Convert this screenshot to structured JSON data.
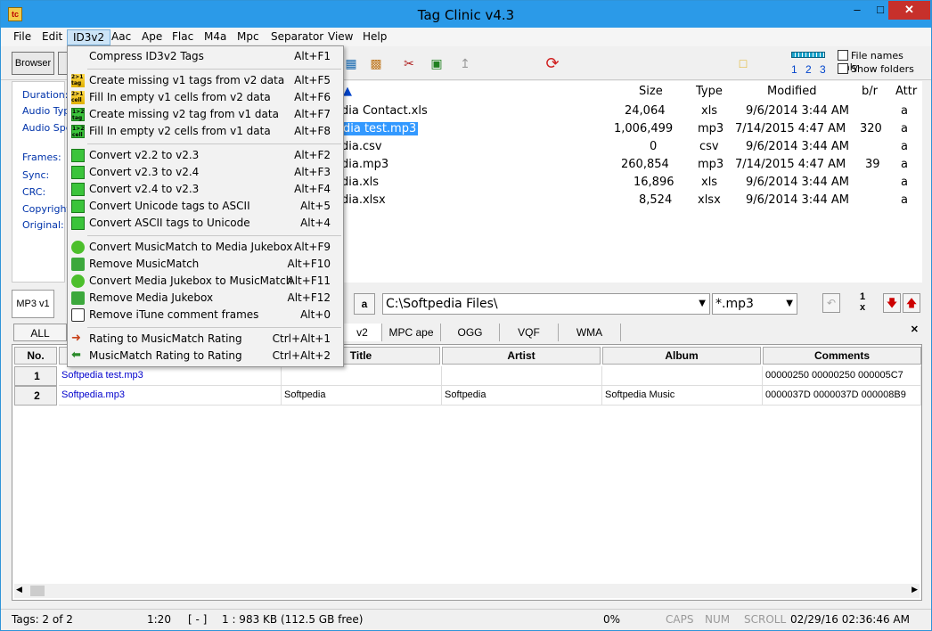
{
  "window": {
    "title": "Tag Clinic v4.3",
    "app_icon": "tag-clinic-icon"
  },
  "menubar": [
    {
      "label": "File"
    },
    {
      "label": "Edit"
    },
    {
      "label": "ID3v2"
    },
    {
      "label": "Aac"
    },
    {
      "label": "Ape"
    },
    {
      "label": "Flac"
    },
    {
      "label": "M4a"
    },
    {
      "label": "Mpc"
    },
    {
      "label": "Separator"
    },
    {
      "label": "View"
    },
    {
      "label": "Help"
    }
  ],
  "toolbar": {
    "browser_label": "Browser",
    "page_numbers": "1 2 3",
    "file_names_only": "File names only",
    "show_folders": "Show folders"
  },
  "id3v2_menu": [
    {
      "label": "Compress  ID3v2 Tags",
      "shortcut": "Alt+F1",
      "icon": "compress-icon"
    },
    {
      "label": "Create   missing v1 tags from v2 data",
      "shortcut": "Alt+F5",
      "icon": "tag-v2-to-v1-icon",
      "icon_text": "2>1 tag"
    },
    {
      "label": "Fill In    empty v1 cells from v2 data",
      "shortcut": "Alt+F6",
      "icon": "cell-v2-to-v1-icon",
      "icon_text": "2>1 cell"
    },
    {
      "label": "Create   missing v2 tag from v1 data",
      "shortcut": "Alt+F7",
      "icon": "tag-v1-to-v2-icon",
      "icon_text": "1>2 tag"
    },
    {
      "label": "Fill In    empty v2 cells from v1 data",
      "shortcut": "Alt+F8",
      "icon": "cell-v1-to-v2-icon",
      "icon_text": "1>2 cell"
    },
    {
      "label": "Convert  v2.2 to v2.3",
      "shortcut": "Alt+F2",
      "icon": "convert-icon"
    },
    {
      "label": "Convert  v2.3 to v2.4",
      "shortcut": "Alt+F3",
      "icon": "convert-icon"
    },
    {
      "label": "Convert  v2.4 to v2.3",
      "shortcut": "Alt+F4",
      "icon": "convert-icon"
    },
    {
      "label": "Convert  Unicode tags to ASCII",
      "shortcut": "Alt+5",
      "icon": "convert-icon"
    },
    {
      "label": "Convert  ASCII tags to Unicode",
      "shortcut": "Alt+4",
      "icon": "convert-icon"
    },
    {
      "label": "Convert  MusicMatch to Media Jukebox",
      "shortcut": "Alt+F9",
      "icon": "musicmatch-icon"
    },
    {
      "label": "Remove  MusicMatch",
      "shortcut": "Alt+F10",
      "icon": "trash-icon"
    },
    {
      "label": "Convert  Media Jukebox to MusicMatch",
      "shortcut": "Alt+F11",
      "icon": "jukebox-icon"
    },
    {
      "label": "Remove  Media Jukebox",
      "shortcut": "Alt+F12",
      "icon": "trash-icon"
    },
    {
      "label": "Remove  iTune comment frames",
      "shortcut": "Alt+0",
      "icon": "itunes-icon"
    },
    {
      "label": "Rating to MusicMatch Rating",
      "shortcut": "Ctrl+Alt+1",
      "icon": "arrow-right-icon"
    },
    {
      "label": "MusicMatch Rating to Rating",
      "shortcut": "Ctrl+Alt+2",
      "icon": "arrow-left-icon"
    }
  ],
  "left_panel": {
    "labels": [
      "Duration:",
      "Audio Type",
      "Audio Spec",
      "Frames:",
      "Sync:",
      "CRC:",
      "Copyright:",
      "Original:"
    ]
  },
  "file_list": {
    "columns": [
      "Size",
      "Type",
      "Modified",
      "b/r",
      "Attr"
    ],
    "rows": [
      {
        "name": "dia Contact.xls",
        "size": "24,064",
        "type": "xls",
        "modified": "9/6/2014 3:44 AM",
        "br": "",
        "attr": "a"
      },
      {
        "name": "dia test.mp3",
        "size": "1,006,499",
        "type": "mp3",
        "modified": "7/14/2015 4:47 AM",
        "br": "320",
        "attr": "a"
      },
      {
        "name": "dia.csv",
        "size": "0",
        "type": "csv",
        "modified": "9/6/2014 3:44 AM",
        "br": "",
        "attr": "a"
      },
      {
        "name": "dia.mp3",
        "size": "260,854",
        "type": "mp3",
        "modified": "7/14/2015 4:47 AM",
        "br": "39",
        "attr": "a"
      },
      {
        "name": "dia.xls",
        "size": "16,896",
        "type": "xls",
        "modified": "9/6/2014 3:44 AM",
        "br": "",
        "attr": "a"
      },
      {
        "name": "dia.xlsx",
        "size": "8,524",
        "type": "xlsx",
        "modified": "9/6/2014 3:44 AM",
        "br": "",
        "attr": "a"
      }
    ]
  },
  "midbar": {
    "mp3_tab": "MP3 v1",
    "a_button": "a",
    "path": "C:\\Softpedia Files\\",
    "filter": "*.mp3",
    "counter_top": "1",
    "counter_bottom": "x"
  },
  "tabs": [
    {
      "label": "ALL"
    },
    {
      "label": "v2"
    },
    {
      "label": "MPC ape"
    },
    {
      "label": "OGG"
    },
    {
      "label": "VQF"
    },
    {
      "label": "WMA"
    }
  ],
  "grid": {
    "headers": [
      "No.",
      "Title",
      "Artist",
      "Album",
      "Comments"
    ],
    "rows": [
      {
        "no": "1",
        "file": "Softpedia test.mp3",
        "title": "",
        "artist": "",
        "album": "",
        "comments": "00000250 00000250 000005C7"
      },
      {
        "no": "2",
        "file": "Softpedia.mp3",
        "title": "Softpedia",
        "artist": "Softpedia",
        "album": "Softpedia Music",
        "comments": "0000037D 0000037D 000008B9"
      }
    ]
  },
  "statusbar": {
    "tags": "Tags: 2 of 2",
    "time": "1:20",
    "bracket": "[ - ]",
    "info": "1  :  983 KB  (112.5 GB free)",
    "percent": "0%",
    "caps": "CAPS",
    "num": "NUM",
    "scroll": "SCROLL",
    "datetime": "02/29/16 02:36:46 AM"
  }
}
